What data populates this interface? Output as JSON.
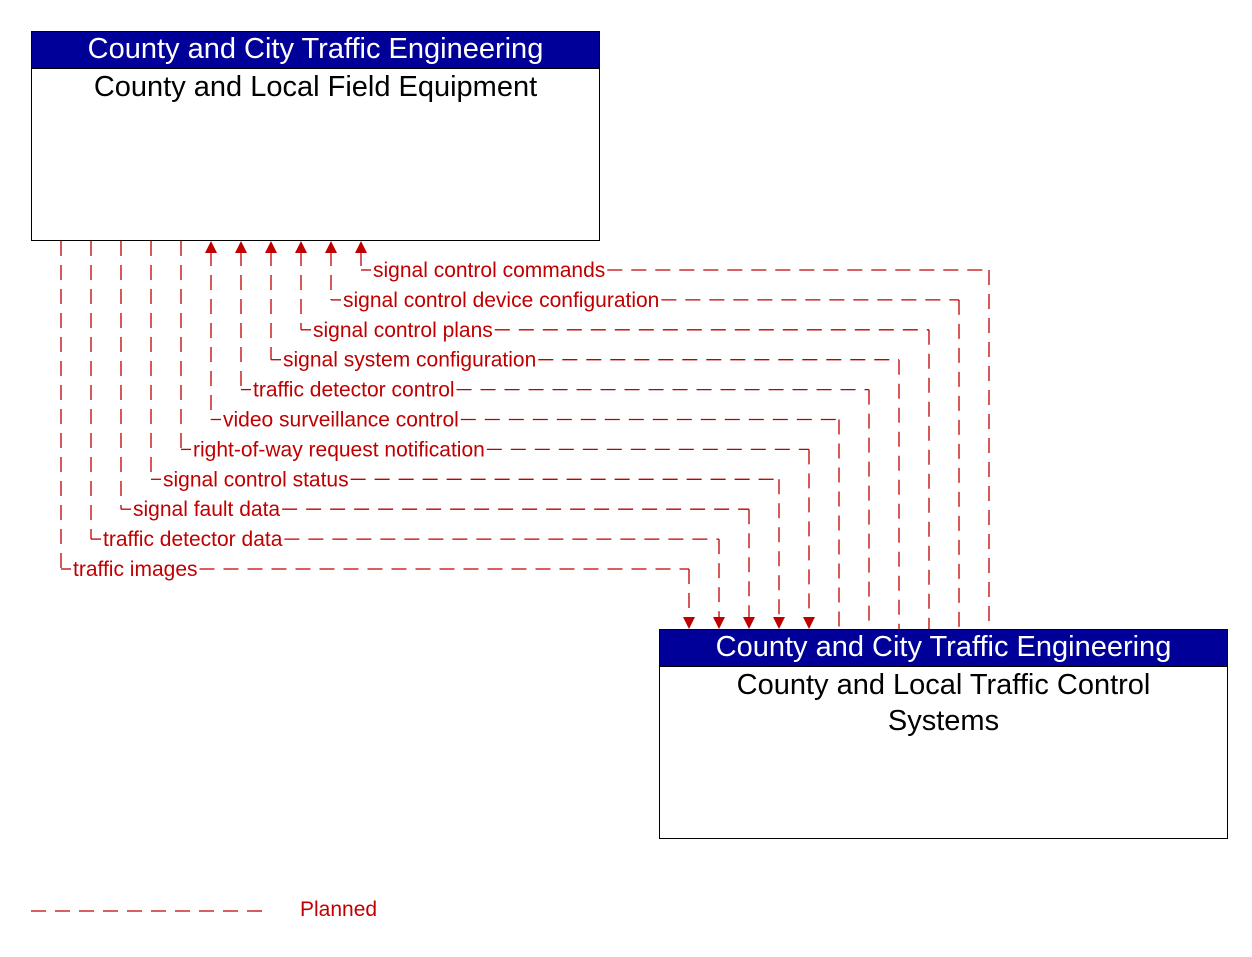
{
  "diagram": {
    "colors": {
      "flow": "#c00000",
      "header_bg": "#000099",
      "header_text": "#ffffff",
      "body_text": "#000000"
    },
    "nodes": {
      "top": {
        "header": "County and City Traffic Engineering",
        "title": "County and Local Field Equipment"
      },
      "bottom": {
        "header": "County and City Traffic Engineering",
        "title_line1": "County and Local Traffic Control",
        "title_line2": "Systems"
      }
    },
    "flows": [
      {
        "label": "signal control commands",
        "direction": "to-top",
        "status": "Planned"
      },
      {
        "label": "signal control device configuration",
        "direction": "to-top",
        "status": "Planned"
      },
      {
        "label": "signal control plans",
        "direction": "to-top",
        "status": "Planned"
      },
      {
        "label": "signal system configuration",
        "direction": "to-top",
        "status": "Planned"
      },
      {
        "label": "traffic detector control",
        "direction": "to-top",
        "status": "Planned"
      },
      {
        "label": "video surveillance control",
        "direction": "to-top",
        "status": "Planned"
      },
      {
        "label": "right-of-way request notification",
        "direction": "to-bottom",
        "status": "Planned"
      },
      {
        "label": "signal control status",
        "direction": "to-bottom",
        "status": "Planned"
      },
      {
        "label": "signal fault data",
        "direction": "to-bottom",
        "status": "Planned"
      },
      {
        "label": "traffic detector data",
        "direction": "to-bottom",
        "status": "Planned"
      },
      {
        "label": "traffic images",
        "direction": "to-bottom",
        "status": "Planned"
      }
    ],
    "legend": {
      "label": "Planned",
      "line_style": "dashed"
    }
  }
}
